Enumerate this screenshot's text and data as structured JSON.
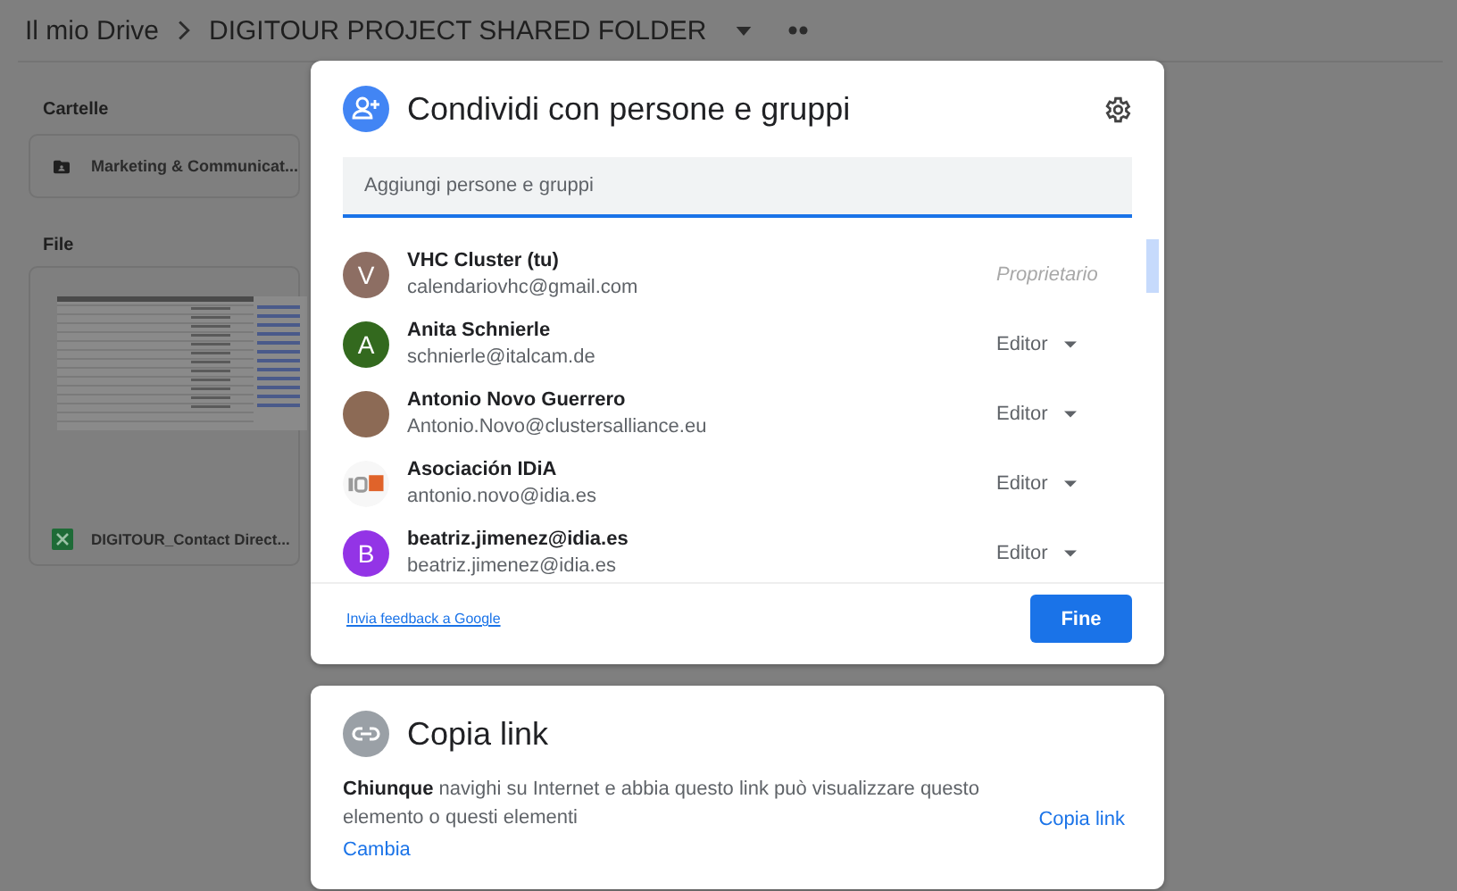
{
  "drive": {
    "breadcrumb": [
      {
        "label": "Il mio Drive"
      },
      {
        "label": "DIGITOUR PROJECT SHARED FOLDER"
      }
    ],
    "folders_heading": "Cartelle",
    "folders": [
      {
        "name": "Marketing & Communicat..."
      }
    ],
    "files_heading": "File",
    "files": [
      {
        "name": "DIGITOUR_Contact Direct...",
        "kind": "sheet"
      }
    ]
  },
  "share_dialog": {
    "title": "Condividi con persone e gruppi",
    "search": {
      "placeholder": "Aggiungi persone e gruppi"
    },
    "people": [
      {
        "name": "VHC Cluster (tu)",
        "email": "calendariovhc@gmail.com",
        "avatar": {
          "kind": "letter",
          "initial": "V",
          "color": "#8d6e63"
        },
        "role": "Proprietario",
        "dropdown": false
      },
      {
        "name": "Anita Schnierle",
        "email": "schnierle@italcam.de",
        "avatar": {
          "kind": "letter",
          "initial": "A",
          "color": "#33691e"
        },
        "role": "Editor",
        "dropdown": true
      },
      {
        "name": "Antonio Novo Guerrero",
        "email": "Antonio.Novo@clustersalliance.eu",
        "avatar": {
          "kind": "photo"
        },
        "role": "Editor",
        "dropdown": true
      },
      {
        "name": "Asociación IDiA",
        "email": "antonio.novo@idia.es",
        "avatar": {
          "kind": "logo"
        },
        "role": "Editor",
        "dropdown": true
      },
      {
        "name": "beatriz.jimenez@idia.es",
        "email": "beatriz.jimenez@idia.es",
        "avatar": {
          "kind": "letter",
          "initial": "B",
          "color": "#9334e6"
        },
        "role": "Editor",
        "dropdown": true
      }
    ],
    "feedback_link": "Invia feedback a Google",
    "done_button": "Fine"
  },
  "link_dialog": {
    "title": "Copia link",
    "description": "**Chiunque** navighi su Internet e abbia questo link può visualizzare questo elemento o questi elementi",
    "change_link": "Cambia",
    "copy_button": "Copia link"
  }
}
